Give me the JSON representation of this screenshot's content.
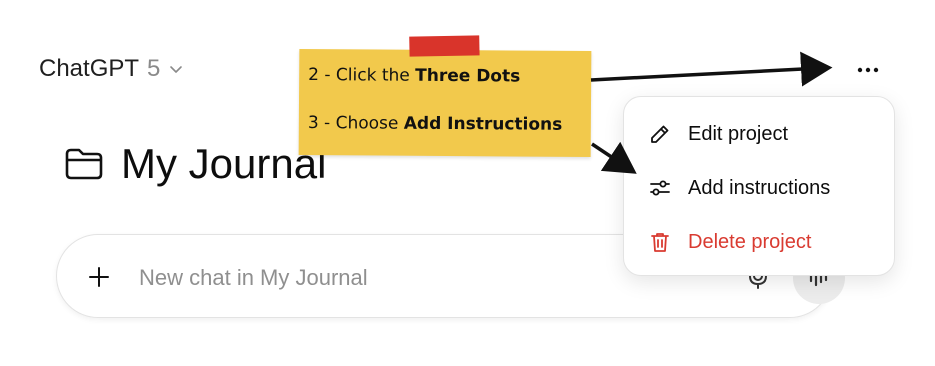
{
  "header": {
    "model_name": "ChatGPT",
    "model_version": "5"
  },
  "project": {
    "title": "My Journal"
  },
  "composer": {
    "placeholder": "New chat in My Journal"
  },
  "menu": {
    "items": [
      {
        "label": "Edit project",
        "icon": "pencil-icon"
      },
      {
        "label": "Add instructions",
        "icon": "sliders-icon"
      },
      {
        "label": "Delete project",
        "icon": "trash-icon",
        "color": "#d93b31"
      }
    ]
  },
  "annotation": {
    "step2_prefix": "2 - Click the ",
    "step2_bold": "Three Dots",
    "step3_prefix": "3 - Choose ",
    "step3_bold": "Add Instructions",
    "note_color": "#f2c94c",
    "tape_color": "#d9342b"
  }
}
